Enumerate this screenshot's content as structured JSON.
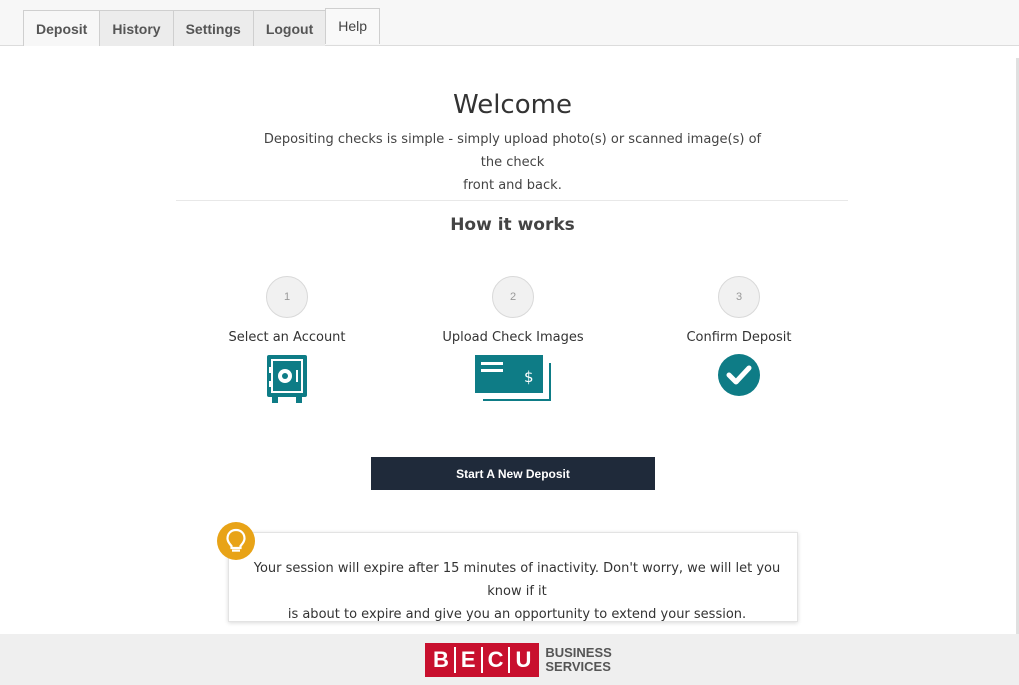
{
  "tabs": [
    {
      "label": "Deposit"
    },
    {
      "label": "History"
    },
    {
      "label": "Settings"
    },
    {
      "label": "Logout"
    },
    {
      "label": "Help"
    }
  ],
  "welcome": {
    "title": "Welcome",
    "text_line1": "Depositing checks is simple - simply upload photo(s) or scanned image(s) of the check",
    "text_line2": "front and back."
  },
  "how_it_works": {
    "title": "How it works",
    "steps": [
      {
        "number": "1",
        "label": "Select an Account",
        "icon": "safe-icon"
      },
      {
        "number": "2",
        "label": "Upload Check Images",
        "icon": "checks-icon"
      },
      {
        "number": "3",
        "label": "Confirm Deposit",
        "icon": "checkmark-circle-icon"
      }
    ]
  },
  "start_button": {
    "label": "Start A New Deposit"
  },
  "notice": {
    "icon": "lightbulb-icon",
    "line1": "Your session will expire after 15 minutes of inactivity. Don't worry, we will let you know if it",
    "line2": "is about to expire and give you an opportunity to extend your session."
  },
  "footer": {
    "logo_letters": [
      "B",
      "E",
      "C",
      "U"
    ],
    "logo_sub_line1": "BUSINESS",
    "logo_sub_line2": "SERVICES"
  },
  "colors": {
    "accent_teal": "#0e7c86",
    "button_navy": "#1f2a3a",
    "bulb_orange": "#e8a317",
    "brand_red": "#c8102e"
  }
}
